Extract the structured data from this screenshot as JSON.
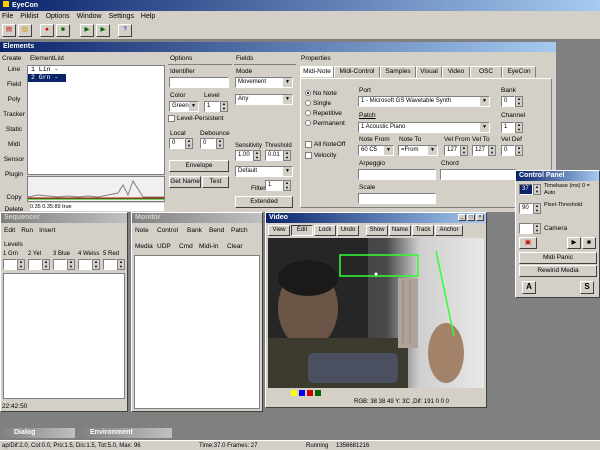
{
  "app": {
    "title": "EyeCon"
  },
  "menu": [
    "File",
    "Piklist",
    "Options",
    "Window",
    "Settings",
    "Help"
  ],
  "elements": {
    "title": "Elements",
    "col_create": "Create",
    "col_list": "ElementList",
    "create_buttons": [
      "Line",
      "Field",
      "Poly",
      "Tracker",
      "Static",
      "Midi",
      "Sensor",
      "Plugin",
      "Copy",
      "Delete"
    ],
    "list_items": [
      "1 Lin  -",
      "2 Grn  -"
    ],
    "graph_readout": "0.35   0.35:89   true"
  },
  "options": {
    "title": "Options",
    "identifier_label": "Identifier",
    "color_label": "Color",
    "color_value": "Green",
    "level_label": "Level",
    "level_value": "1",
    "level_persistent": "Level-Persistent",
    "local_label": "Local",
    "local_value": "0",
    "debounce_label": "Debounce",
    "debounce_value": "0",
    "envelope": "Envelope",
    "getname": "Get Name",
    "test": "Test"
  },
  "fields": {
    "title": "Fields",
    "mode_label": "Mode",
    "mode_value": "Movement",
    "any_value": "Any",
    "sensitivity_label": "Sensitivity",
    "sensitivity_value": "1.00",
    "threshold_label": "Threshold",
    "threshold_value": "0.01",
    "default_value": "Default",
    "filter_label": "Filter",
    "filter_value": "1",
    "extended": "Extended"
  },
  "properties": {
    "title": "Properties",
    "tabs": [
      "Midi-Note",
      "Midi-Control",
      "Samples",
      "Visual",
      "Video",
      "OSC",
      "EyeCon"
    ],
    "radio_options": [
      "No Note",
      "Single",
      "Repetitive",
      "Permanent"
    ],
    "all_noteoff": "All NoteOff",
    "velocity": "Velocity",
    "port_label": "Port",
    "port_value": "1 - Microsoft GS Wavetable Synth",
    "patch_label": "Patch",
    "patch_value": "1 Acoustic Piano",
    "bank_label": "Bank",
    "bank_value": "0",
    "channel_label": "Channel",
    "channel_value": "1",
    "note_from_label": "Note From",
    "note_from_value": "60 C5",
    "note_to_label": "Note To",
    "note_to_value": "=From",
    "vel_from_label": "Vel From",
    "vel_from_value": "127",
    "vel_to_label": "Vel To",
    "vel_to_value": "127",
    "vel_def_label": "Vel Def",
    "vel_def_value": "0",
    "arpeggio_label": "Arpeggio",
    "chord_label": "Chord",
    "scale_label": "Scale"
  },
  "control_panel": {
    "title": "Control Panel",
    "timebase_value": "37",
    "timebase_label": "Timebase (ms) 0 = Auto",
    "pixel_threshold_value": "90",
    "pixel_threshold_label": "Pixel-Threshold",
    "camera_label": "Camera",
    "midi_panic": "Midi Panic",
    "rewind": "Rewind Media",
    "a": "A",
    "s": "S"
  },
  "sequencer": {
    "title": "Sequencer",
    "menu": [
      "Edit",
      "Run",
      "Insert"
    ],
    "levels_label": "Levels",
    "levels": [
      "1 Grn",
      "2 Yel",
      "3 Blue",
      "4 Weiss",
      "5 Red"
    ],
    "time": "22:42:50"
  },
  "monitor": {
    "title": "Monitor",
    "row1": [
      "Note",
      "Control",
      "Bank",
      "Bend",
      "Patch"
    ],
    "row2": [
      "Media",
      "UDP",
      "Cmd",
      "Midi-In",
      "Clear"
    ]
  },
  "video": {
    "title": "Video",
    "toolbar": [
      "View",
      "Edit",
      "Lock",
      "Undo",
      "Show",
      "Name",
      "Track",
      "Anchor"
    ],
    "status": "RGB: 38 38 49  Y: 3C ,Dif: 191 0 0 0"
  },
  "taskbar": {
    "dialog": "Dialog",
    "environment": "Environment"
  },
  "statusbar": {
    "left": "ap/Dif:2.0, Col:0.0, Pro:1.5, Dis:1.5, Tot:5.0, Max: 96",
    "time": "Time:37.0 Frames: 27",
    "running": "Running",
    "ticks": "1356681216"
  },
  "colors": {
    "titlebar": "#0a246a",
    "face": "#d4d0c8",
    "field_line": "#30ff30"
  }
}
